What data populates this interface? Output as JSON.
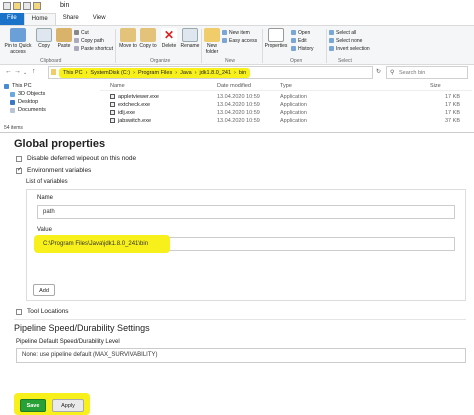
{
  "explorer": {
    "title": "bin",
    "tabs": [
      "File",
      "Home",
      "Share",
      "View"
    ],
    "ribbon": {
      "pin": "Pin to Quick access",
      "copy": "Copy",
      "paste": "Paste",
      "cut": "Cut",
      "copy_path": "Copy path",
      "paste_shortcut": "Paste shortcut",
      "move_to": "Move to",
      "copy_to": "Copy to",
      "delete": "Delete",
      "rename": "Rename",
      "new_folder": "New folder",
      "new_item": "New item",
      "easy_access": "Easy access",
      "properties": "Properties",
      "open": "Open",
      "edit": "Edit",
      "history": "History",
      "select_all": "Select all",
      "select_none": "Select none",
      "invert_selection": "Invert selection",
      "groups": [
        "Clipboard",
        "Organize",
        "New",
        "Open",
        "Select"
      ]
    },
    "breadcrumbs": [
      "This PC",
      "SystemDisk (C:)",
      "Program Files",
      "Java",
      "jdk1.8.0_241",
      "bin"
    ],
    "search_placeholder": "Search bin",
    "nav": {
      "items": [
        "This PC",
        "3D Objects",
        "Desktop",
        "Documents"
      ],
      "count": "54 items"
    },
    "columns": [
      "Name",
      "Date modified",
      "Type",
      "Size"
    ],
    "files": [
      {
        "name": "appletviewer.exe",
        "date": "13.04.2020 10:59",
        "type": "Application",
        "size": "17 KB"
      },
      {
        "name": "extcheck.exe",
        "date": "13.04.2020 10:59",
        "type": "Application",
        "size": "17 KB"
      },
      {
        "name": "idlj.exe",
        "date": "13.04.2020 10:59",
        "type": "Application",
        "size": "17 KB"
      },
      {
        "name": "jabswitch.exe",
        "date": "13.04.2020 10:59",
        "type": "Application",
        "size": "37 KB"
      }
    ]
  },
  "jenkins": {
    "section_title": "Global properties",
    "disable_deferred": "Disable deferred wipeout on this node",
    "env_vars": "Environment variables",
    "list_label": "List of variables",
    "name_label": "Name",
    "name_value": "path",
    "value_label": "Value",
    "value_value": "C:\\Program Files\\Java\\jdk1.8.0_241\\bin",
    "add_button": "Add",
    "tool_locations": "Tool Locations",
    "pipeline_title": "Pipeline Speed/Durability Settings",
    "pipeline_label": "Pipeline Default Speed/Durability Level",
    "pipeline_value": "None: use pipeline default (MAX_SURVIVABILITY)",
    "save_button": "Save",
    "apply_button": "Apply"
  }
}
